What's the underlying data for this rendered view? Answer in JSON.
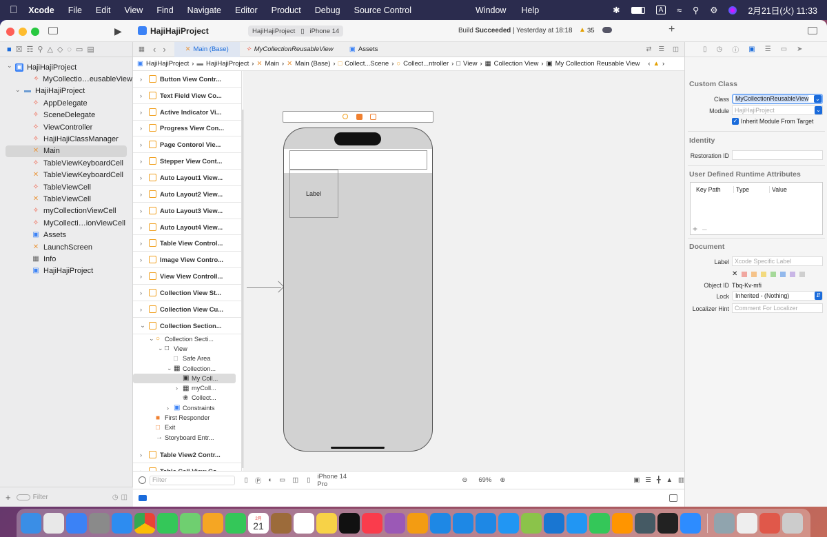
{
  "menubar": {
    "apple": "",
    "app": "Xcode",
    "items": [
      "File",
      "Edit",
      "View",
      "Find",
      "Navigate",
      "Editor",
      "Product",
      "Debug",
      "Source Control"
    ],
    "center_items": [
      "Window",
      "Help"
    ],
    "input_mode": "A",
    "datetime": "2月21日(火) 11:33"
  },
  "toolbar": {
    "project": "HajiHajiProject",
    "scheme": "HajiHajiProject",
    "device": "iPhone 14",
    "status_prefix": "Build ",
    "status_bold": "Succeeded",
    "status_time": " | Yesterday at 18:18",
    "warnings": "35"
  },
  "navigator": {
    "items": [
      {
        "label": "HajiHajiProject",
        "icon": "project",
        "indent": 0
      },
      {
        "label": "MyCollectio…eusableView",
        "icon": "swift",
        "indent": 2
      },
      {
        "label": "HajiHajiProject",
        "icon": "folder",
        "indent": 1
      },
      {
        "label": "AppDelegate",
        "icon": "swift",
        "indent": 3
      },
      {
        "label": "SceneDelegate",
        "icon": "swift",
        "indent": 3
      },
      {
        "label": "ViewController",
        "icon": "swift",
        "indent": 3
      },
      {
        "label": "HajiHajiClassManager",
        "icon": "swift",
        "indent": 3
      },
      {
        "label": "Main",
        "icon": "xib",
        "indent": 3,
        "selected": true
      },
      {
        "label": "TableViewKeyboardCell",
        "icon": "swift",
        "indent": 3
      },
      {
        "label": "TableViewKeyboardCell",
        "icon": "xib",
        "indent": 3
      },
      {
        "label": "TableViewCell",
        "icon": "swift",
        "indent": 3
      },
      {
        "label": "TableViewCell",
        "icon": "xib",
        "indent": 3
      },
      {
        "label": "myCollectionViewCell",
        "icon": "swift",
        "indent": 3
      },
      {
        "label": "MyCollecti…ionViewCell",
        "icon": "swift",
        "indent": 3
      },
      {
        "label": "Assets",
        "icon": "assets",
        "indent": 3
      },
      {
        "label": "LaunchScreen",
        "icon": "xib",
        "indent": 3
      },
      {
        "label": "Info",
        "icon": "table",
        "indent": 3
      },
      {
        "label": "HajiHajiProject",
        "icon": "project2",
        "indent": 3
      }
    ],
    "filter_placeholder": "Filter"
  },
  "tabs": [
    "Main (Base)",
    "MyCollectionReusableView",
    "Assets"
  ],
  "jumpbar": [
    "HajiHajiProject",
    "HajiHajiProject",
    "Main",
    "Main (Base)",
    "Collect...Scene",
    "Collect...ntroller",
    "View",
    "Collection View",
    "My Collection Reusable View"
  ],
  "outline": {
    "scenes_top": [
      "Button View Contr...",
      "Text Field View Co...",
      "Active Indicator Vi...",
      "Progress View Con...",
      "Page Contorol Vie...",
      "Stepper View Cont...",
      "Auto Layout1 View...",
      "Auto Layout2 View...",
      "Auto Layout3 View...",
      "Auto Layout4 View...",
      "Table View Control...",
      "Image View Contro...",
      "View View Controll...",
      "Collection View St...",
      "Collection View Cu..."
    ],
    "expanded_scene": "Collection Section...",
    "children": [
      {
        "label": "Collection Secti...",
        "indent": 1
      },
      {
        "label": "View",
        "indent": 2
      },
      {
        "label": "Safe Area",
        "indent": 3
      },
      {
        "label": "Collection...",
        "indent": 3
      },
      {
        "label": "My Coll...",
        "indent": 4,
        "selected": true
      },
      {
        "label": "myColl...",
        "indent": 4
      },
      {
        "label": "Collect...",
        "indent": 4
      },
      {
        "label": "Constraints",
        "indent": 3
      },
      {
        "label": "First Responder",
        "indent": 1
      },
      {
        "label": "Exit",
        "indent": 1
      },
      {
        "label": "Storyboard Entr...",
        "indent": 1
      }
    ],
    "scenes_bottom": [
      "Table View2 Contr...",
      "Table Cell View Co..."
    ],
    "filter_placeholder": "Filter"
  },
  "canvas": {
    "cell_label": "Label"
  },
  "bottombar": {
    "device": "iPhone 14 Pro",
    "zoom": "69%"
  },
  "inspector": {
    "custom_class_title": "Custom Class",
    "class_label": "Class",
    "class_value": "MyCollectionReusableView",
    "module_label": "Module",
    "module_placeholder": "HajiHajiProject",
    "inherit_label": "Inherit Module From Target",
    "identity_title": "Identity",
    "restoration_label": "Restoration ID",
    "udra_title": "User Defined Runtime Attributes",
    "udra_cols": [
      "Key Path",
      "Type",
      "Value"
    ],
    "document_title": "Document",
    "doc_label_label": "Label",
    "doc_label_placeholder": "Xcode Specific Label",
    "object_id_label": "Object ID",
    "object_id_value": "Tbq-Kv-mfi",
    "lock_label": "Lock",
    "lock_value": "Inherited - (Nothing)",
    "localizer_label": "Localizer Hint",
    "localizer_placeholder": "Comment For Localizer",
    "label_colors": [
      "#f0a7a0",
      "#f5c38a",
      "#f3da7e",
      "#a6d99a",
      "#93b9ec",
      "#c9b6e6",
      "#cfcfcf"
    ]
  },
  "dock": {
    "calendar_month": "2月",
    "calendar_day": "21",
    "apps": [
      "finder",
      "launchpad",
      "mail",
      "settings",
      "safari",
      "chrome",
      "messages",
      "maps",
      "photos",
      "facetime",
      "calendar",
      "notes-brown",
      "reminders",
      "notes",
      "appletv",
      "music",
      "podcasts",
      "books",
      "xcode",
      "xcode-beta",
      "appstore-blue",
      "appstore",
      "coteditor",
      "vscode",
      "keynote",
      "numbers",
      "pages",
      "simulator",
      "terminal",
      "zoom",
      "preview",
      "textedit",
      "kotoeri",
      "trash"
    ]
  }
}
